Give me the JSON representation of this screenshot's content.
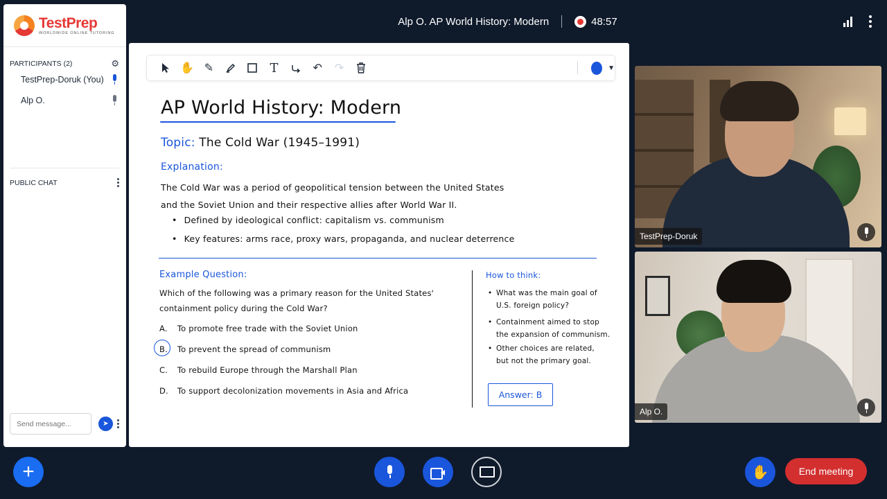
{
  "header": {
    "meeting_title": "Alp O. AP World History: Modern",
    "recording_timer": "48:57",
    "recording_icon": "record-icon",
    "signal_icon": "signal-bars-icon",
    "menu_icon": "kebab-menu-icon"
  },
  "sidebar": {
    "logo_name": "TestPrep",
    "logo_tagline": "WORLDWIDE ONLINE TUTORING",
    "participants_title": "PARTICIPANTS (2)",
    "participants": [
      {
        "name": "TestPrep-Doruk (You)",
        "mic": "on"
      },
      {
        "name": "Alp O.",
        "mic": "off"
      }
    ],
    "public_chat_title": "PUBLIC CHAT",
    "chat_placeholder": "Send message..."
  },
  "toolbar": {
    "tools": [
      "select-tool-icon",
      "pan-hand-icon",
      "pencil-icon",
      "highlighter-icon",
      "rectangle-icon",
      "text-tool-icon",
      "connector-icon",
      "undo-icon",
      "redo-icon",
      "trash-icon"
    ],
    "current_color": "#1a56db"
  },
  "whiteboard": {
    "title": "AP World History: Modern",
    "topic_label": "Topic:",
    "topic_value": "The Cold War (1945–1991)",
    "explanation_label": "Explanation:",
    "explanation_line1": "The Cold War was a period of geopolitical tension between the United States",
    "explanation_line2": "and the Soviet Union and their respective allies after World War II.",
    "bullets": [
      "Defined by ideological conflict: capitalism vs. communism",
      "Key features: arms race, proxy wars, propaganda, and nuclear deterrence"
    ],
    "example_label": "Example Question:",
    "question_line1": "Which of the following was a primary reason for the United States'",
    "question_line2": "containment policy during the Cold War?",
    "options": [
      {
        "letter": "A.",
        "text": "To promote free trade with the Soviet Union"
      },
      {
        "letter": "B.",
        "text": "To prevent the spread of communism"
      },
      {
        "letter": "C.",
        "text": "To rebuild Europe through the Marshall Plan"
      },
      {
        "letter": "D.",
        "text": "To support decolonization movements in Asia and Africa"
      }
    ],
    "circled_option": "B.",
    "how_to_think_label": "How to think:",
    "how_to_think": [
      {
        "line1": "What was the main goal of",
        "line2": "U.S. foreign policy?"
      },
      {
        "line1": "Containment aimed to stop",
        "line2": "the expansion of communism."
      },
      {
        "line1": "Other choices are related,",
        "line2": "but not the primary goal."
      }
    ],
    "answer": "Answer: B"
  },
  "videos": [
    {
      "name": "TestPrep-Doruk"
    },
    {
      "name": "Alp O."
    }
  ],
  "controls": {
    "end_meeting": "End meeting",
    "accent_color": "#1a56db",
    "end_color": "#d32f2f"
  }
}
